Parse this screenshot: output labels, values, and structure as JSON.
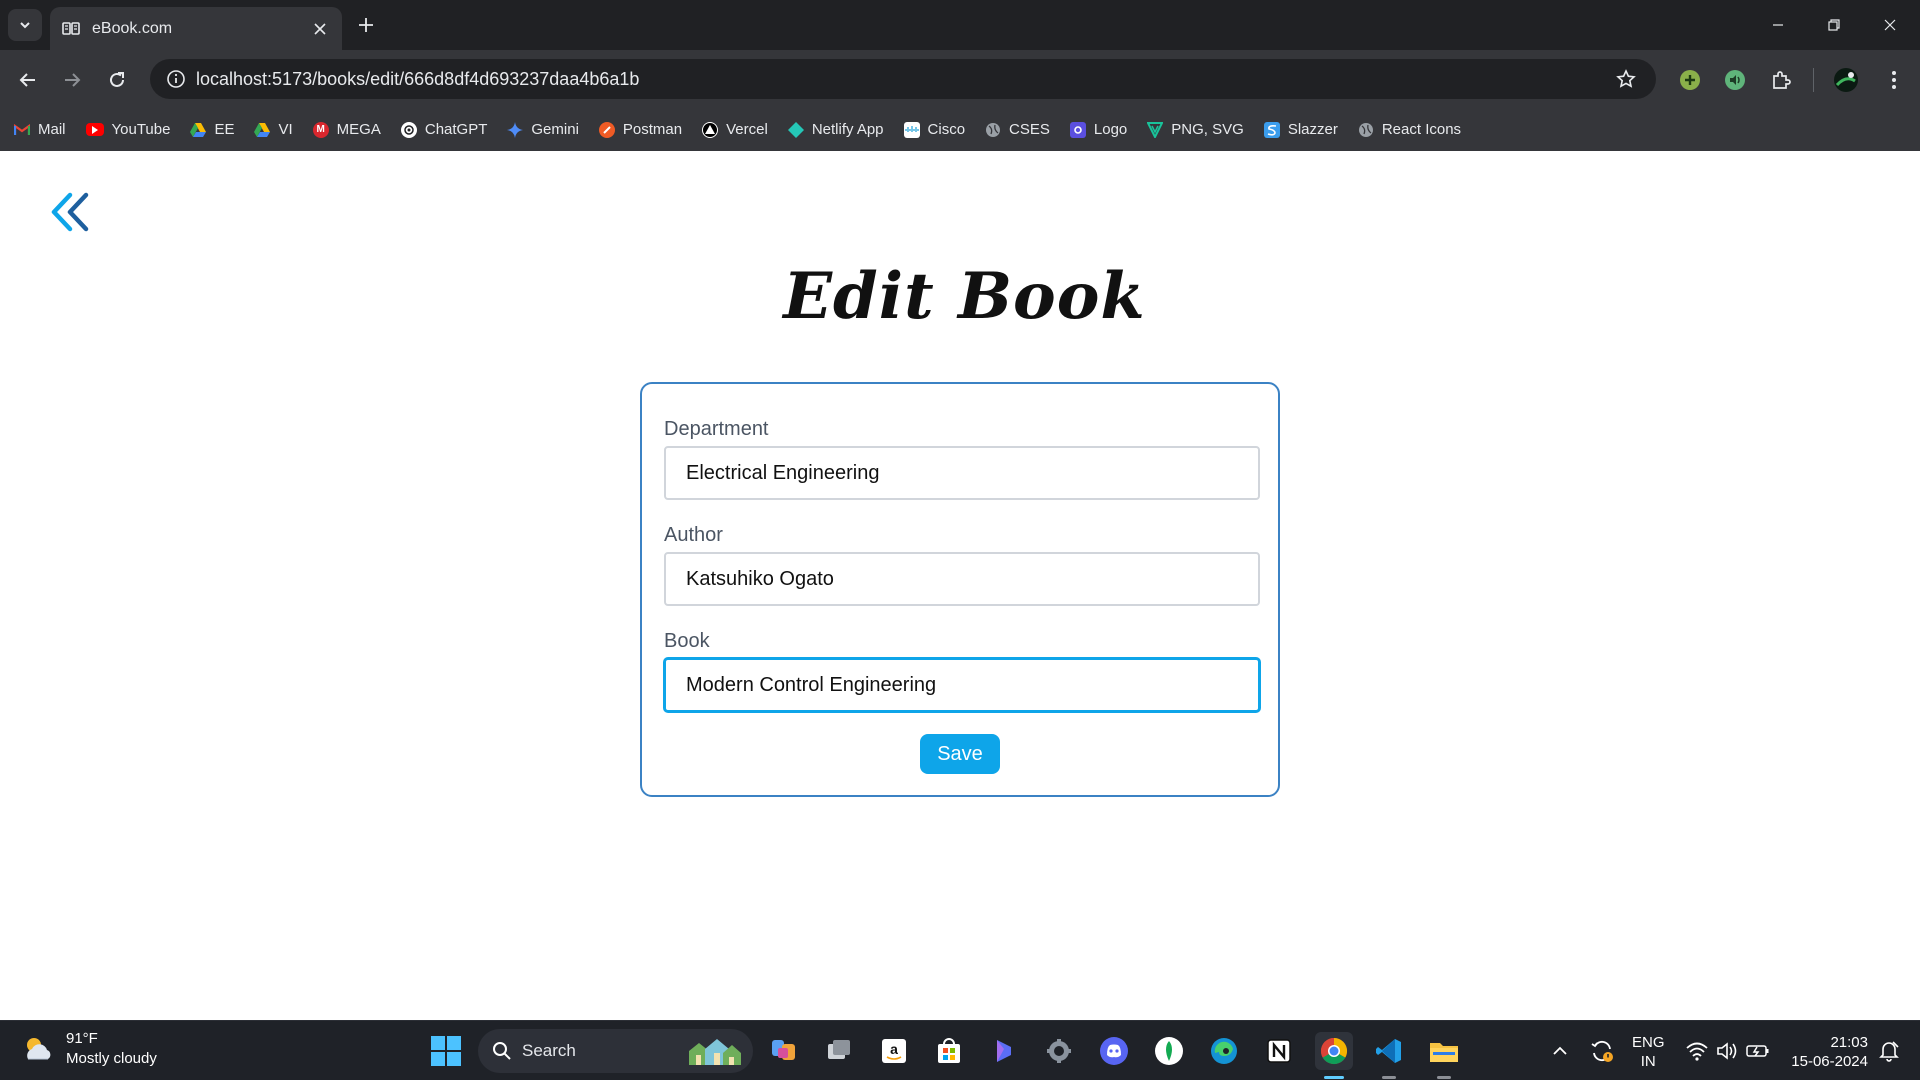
{
  "browser": {
    "tab": {
      "title": "eBook.com"
    },
    "url": "localhost:5173/books/edit/666d8df4d693237daa4b6a1b",
    "bookmarks": [
      {
        "label": "Mail",
        "icon": "gmail-icon",
        "color": "#ea4335"
      },
      {
        "label": "YouTube",
        "icon": "youtube-icon",
        "color": "#ff0000"
      },
      {
        "label": "EE",
        "icon": "google-drive-icon",
        "color": "#34a853"
      },
      {
        "label": "VI",
        "icon": "google-drive-icon",
        "color": "#34a853"
      },
      {
        "label": "MEGA",
        "icon": "mega-icon",
        "color": "#d9272e"
      },
      {
        "label": "ChatGPT",
        "icon": "chatgpt-icon",
        "color": "#ffffff"
      },
      {
        "label": "Gemini",
        "icon": "gemini-icon",
        "color": "#4f8cf7"
      },
      {
        "label": "Postman",
        "icon": "postman-icon",
        "color": "#ef5b25"
      },
      {
        "label": "Vercel",
        "icon": "vercel-icon",
        "color": "#000000"
      },
      {
        "label": "Netlify App",
        "icon": "netlify-icon",
        "color": "#25c7b7"
      },
      {
        "label": "Cisco",
        "icon": "cisco-icon",
        "color": "#1ba0d7"
      },
      {
        "label": "CSES",
        "icon": "globe-icon",
        "color": "#9aa0a6"
      },
      {
        "label": "Logo",
        "icon": "logo-icon",
        "color": "#5b4fe0"
      },
      {
        "label": "PNG, SVG",
        "icon": "png-svg-icon",
        "color": "#19c39a"
      },
      {
        "label": "Slazzer",
        "icon": "slazzer-icon",
        "color": "#3b9ded"
      },
      {
        "label": "React Icons",
        "icon": "globe-icon",
        "color": "#9aa0a6"
      }
    ]
  },
  "page": {
    "title": "Edit Book",
    "fields": {
      "department": {
        "label": "Department",
        "value": "Electrical Engineering"
      },
      "author": {
        "label": "Author",
        "value": "Katsuhiko Ogato"
      },
      "book": {
        "label": "Book",
        "value": "Modern Control Engineering"
      }
    },
    "save_label": "Save",
    "accent": "#0ea5e9",
    "card_border": "#3b82c4"
  },
  "taskbar": {
    "weather": {
      "temp": "91°F",
      "condition": "Mostly cloudy"
    },
    "search_label": "Search",
    "apps": [
      "copilot-icon",
      "task-view-icon",
      "amazon-icon",
      "store-icon",
      "bing-icon",
      "settings-icon",
      "discord-icon",
      "mongodb-icon",
      "edge-icon",
      "notion-icon",
      "chrome-icon",
      "vscode-icon",
      "file-explorer-icon"
    ],
    "language": {
      "line1": "ENG",
      "line2": "IN"
    },
    "time": "21:03",
    "date": "15-06-2024"
  }
}
